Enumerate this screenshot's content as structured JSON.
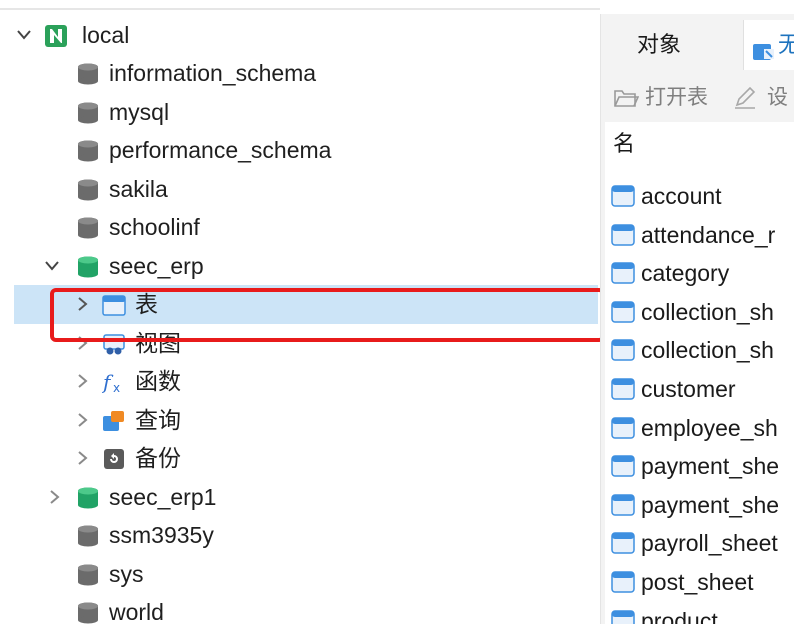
{
  "tree": {
    "local": "local",
    "databases": [
      "information_schema",
      "mysql",
      "performance_schema",
      "sakila",
      "schoolinf",
      "seec_erp"
    ],
    "seec_children": [
      "表",
      "视图",
      "函数",
      "查询",
      "备份"
    ],
    "databases_after": [
      "seec_erp1",
      "ssm3935y",
      "sys",
      "world"
    ]
  },
  "panel": {
    "tabs": {
      "objects": "对象",
      "untitled": "无"
    },
    "toolbar": {
      "open_table": "打开表",
      "design": "设"
    },
    "column_header": "名",
    "tables": [
      "account",
      "attendance_r",
      "category",
      "collection_sh",
      "collection_sh",
      "customer",
      "employee_sh",
      "payment_she",
      "payment_she",
      "payroll_sheet",
      "post_sheet",
      "product"
    ]
  },
  "colors": {
    "selection": "#cce4f7",
    "highlight_border": "#e81b1b",
    "active_db": "#21a366",
    "inactive_db": "#6b6b6b",
    "table_icon": "#3d8fe0"
  }
}
